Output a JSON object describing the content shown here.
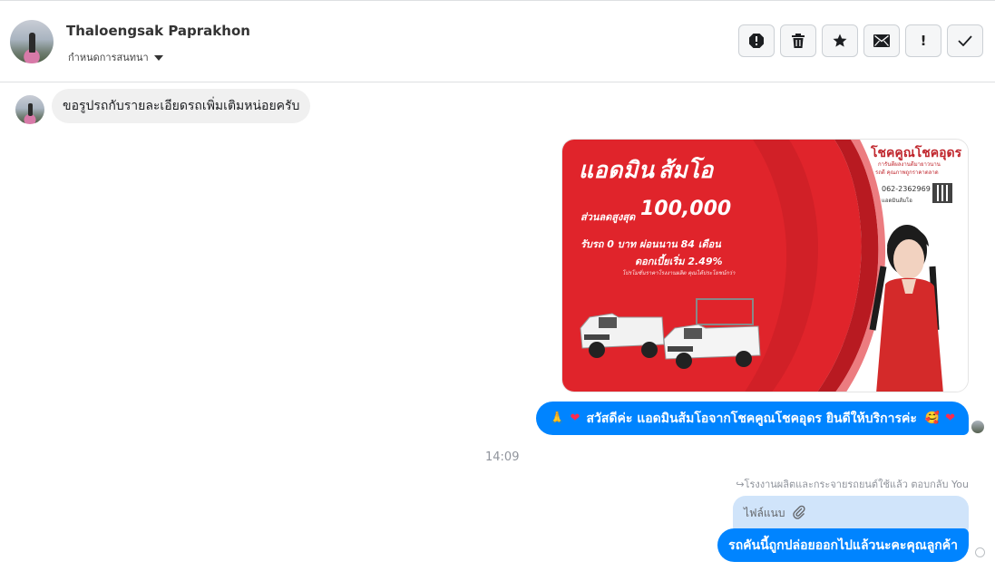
{
  "conversation": {
    "contact_name": "Thaloengsak Paprakhon",
    "subtitle": "กำหนดการสนทนา",
    "toolbar": [
      {
        "name": "report-button",
        "icon": "alert-octagon-icon"
      },
      {
        "name": "delete-button",
        "icon": "trash-icon"
      },
      {
        "name": "star-button",
        "icon": "star-icon"
      },
      {
        "name": "mark-unread-button",
        "icon": "envelope-icon"
      },
      {
        "name": "important-button",
        "icon": "exclamation-icon",
        "label": "!"
      },
      {
        "name": "done-button",
        "icon": "check-icon"
      }
    ]
  },
  "messages": {
    "incoming_1": "ขอรูปรถกับรายละเอียดรถเพิ่มเติมหน่อยครับ",
    "ad_image": {
      "headline_left": "แอดมิน",
      "headline_right": "ส้มโอ",
      "discount_label": "ส่วนลดสูงสุด",
      "discount_value": "100,000",
      "promo_line_1": "รับรถ 0 บาท ผ่อนนาน 84 เดือน",
      "promo_line_2": "ดอกเบี้ยเริ่ม 2.49%",
      "promo_small": "โปรโมชั่นราคาโรงงานผลิต คุณได้ประโยชน์กว่า",
      "brand": "โชคคูณโชคอุดร",
      "brand_sub_1": "การันตีผลงานดีมายาวนาน",
      "brand_sub_2": "รถดี คุณภาพถูกราคาตลาด",
      "phone": "062-2362969",
      "contact_name": "แอดมินส้มโอ",
      "accent_color": "#e0242b"
    },
    "outgoing_1": {
      "text": "สวัสดีค่ะ แอดมินส้มโอจากโชคคูณโชคอุดร ยินดีให้บริการค่ะ",
      "prefix_emoji": "🙏",
      "prefix_heart": "❤",
      "suffix_emoji": "🥰",
      "suffix_heart": "❤"
    },
    "timestamp": "14:09",
    "reply_meta": "โรงงานผลิตและกระจายรถยนต์ใช้แล้ว ตอบกลับ You",
    "reply_preview_text": "ไฟล์แนบ",
    "outgoing_2": "รถคันนี้ถูกปล่อยออกไปแล้วนะคะคุณลูกค้า"
  },
  "colors": {
    "outgoing_bubble": "#0084ff",
    "incoming_bubble": "#f0f0f0",
    "reply_preview_bg": "#d0e4fa"
  }
}
